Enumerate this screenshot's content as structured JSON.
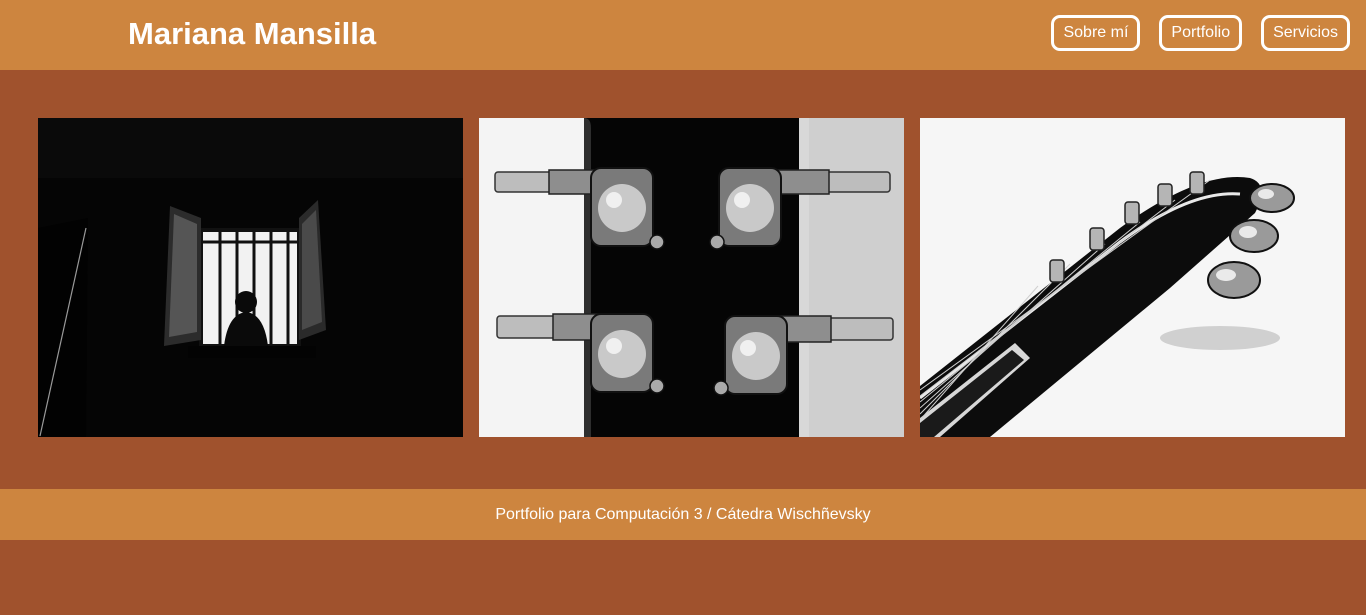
{
  "colors": {
    "background": "#a0522d",
    "header": "#cd853f",
    "footer": "#cd853f",
    "text": "#ffffff"
  },
  "header": {
    "title": "Mariana Mansilla",
    "nav": [
      {
        "label": "Sobre mí"
      },
      {
        "label": "Portfolio"
      },
      {
        "label": "Servicios"
      }
    ]
  },
  "gallery": {
    "images": [
      {
        "subject": "silhouette-at-barred-window"
      },
      {
        "subject": "guitar-headstock-tuning-pegs"
      },
      {
        "subject": "guitar-neck-headstock-angle"
      }
    ]
  },
  "footer": {
    "text": "Portfolio para Computación 3 / Cátedra Wischñevsky"
  }
}
